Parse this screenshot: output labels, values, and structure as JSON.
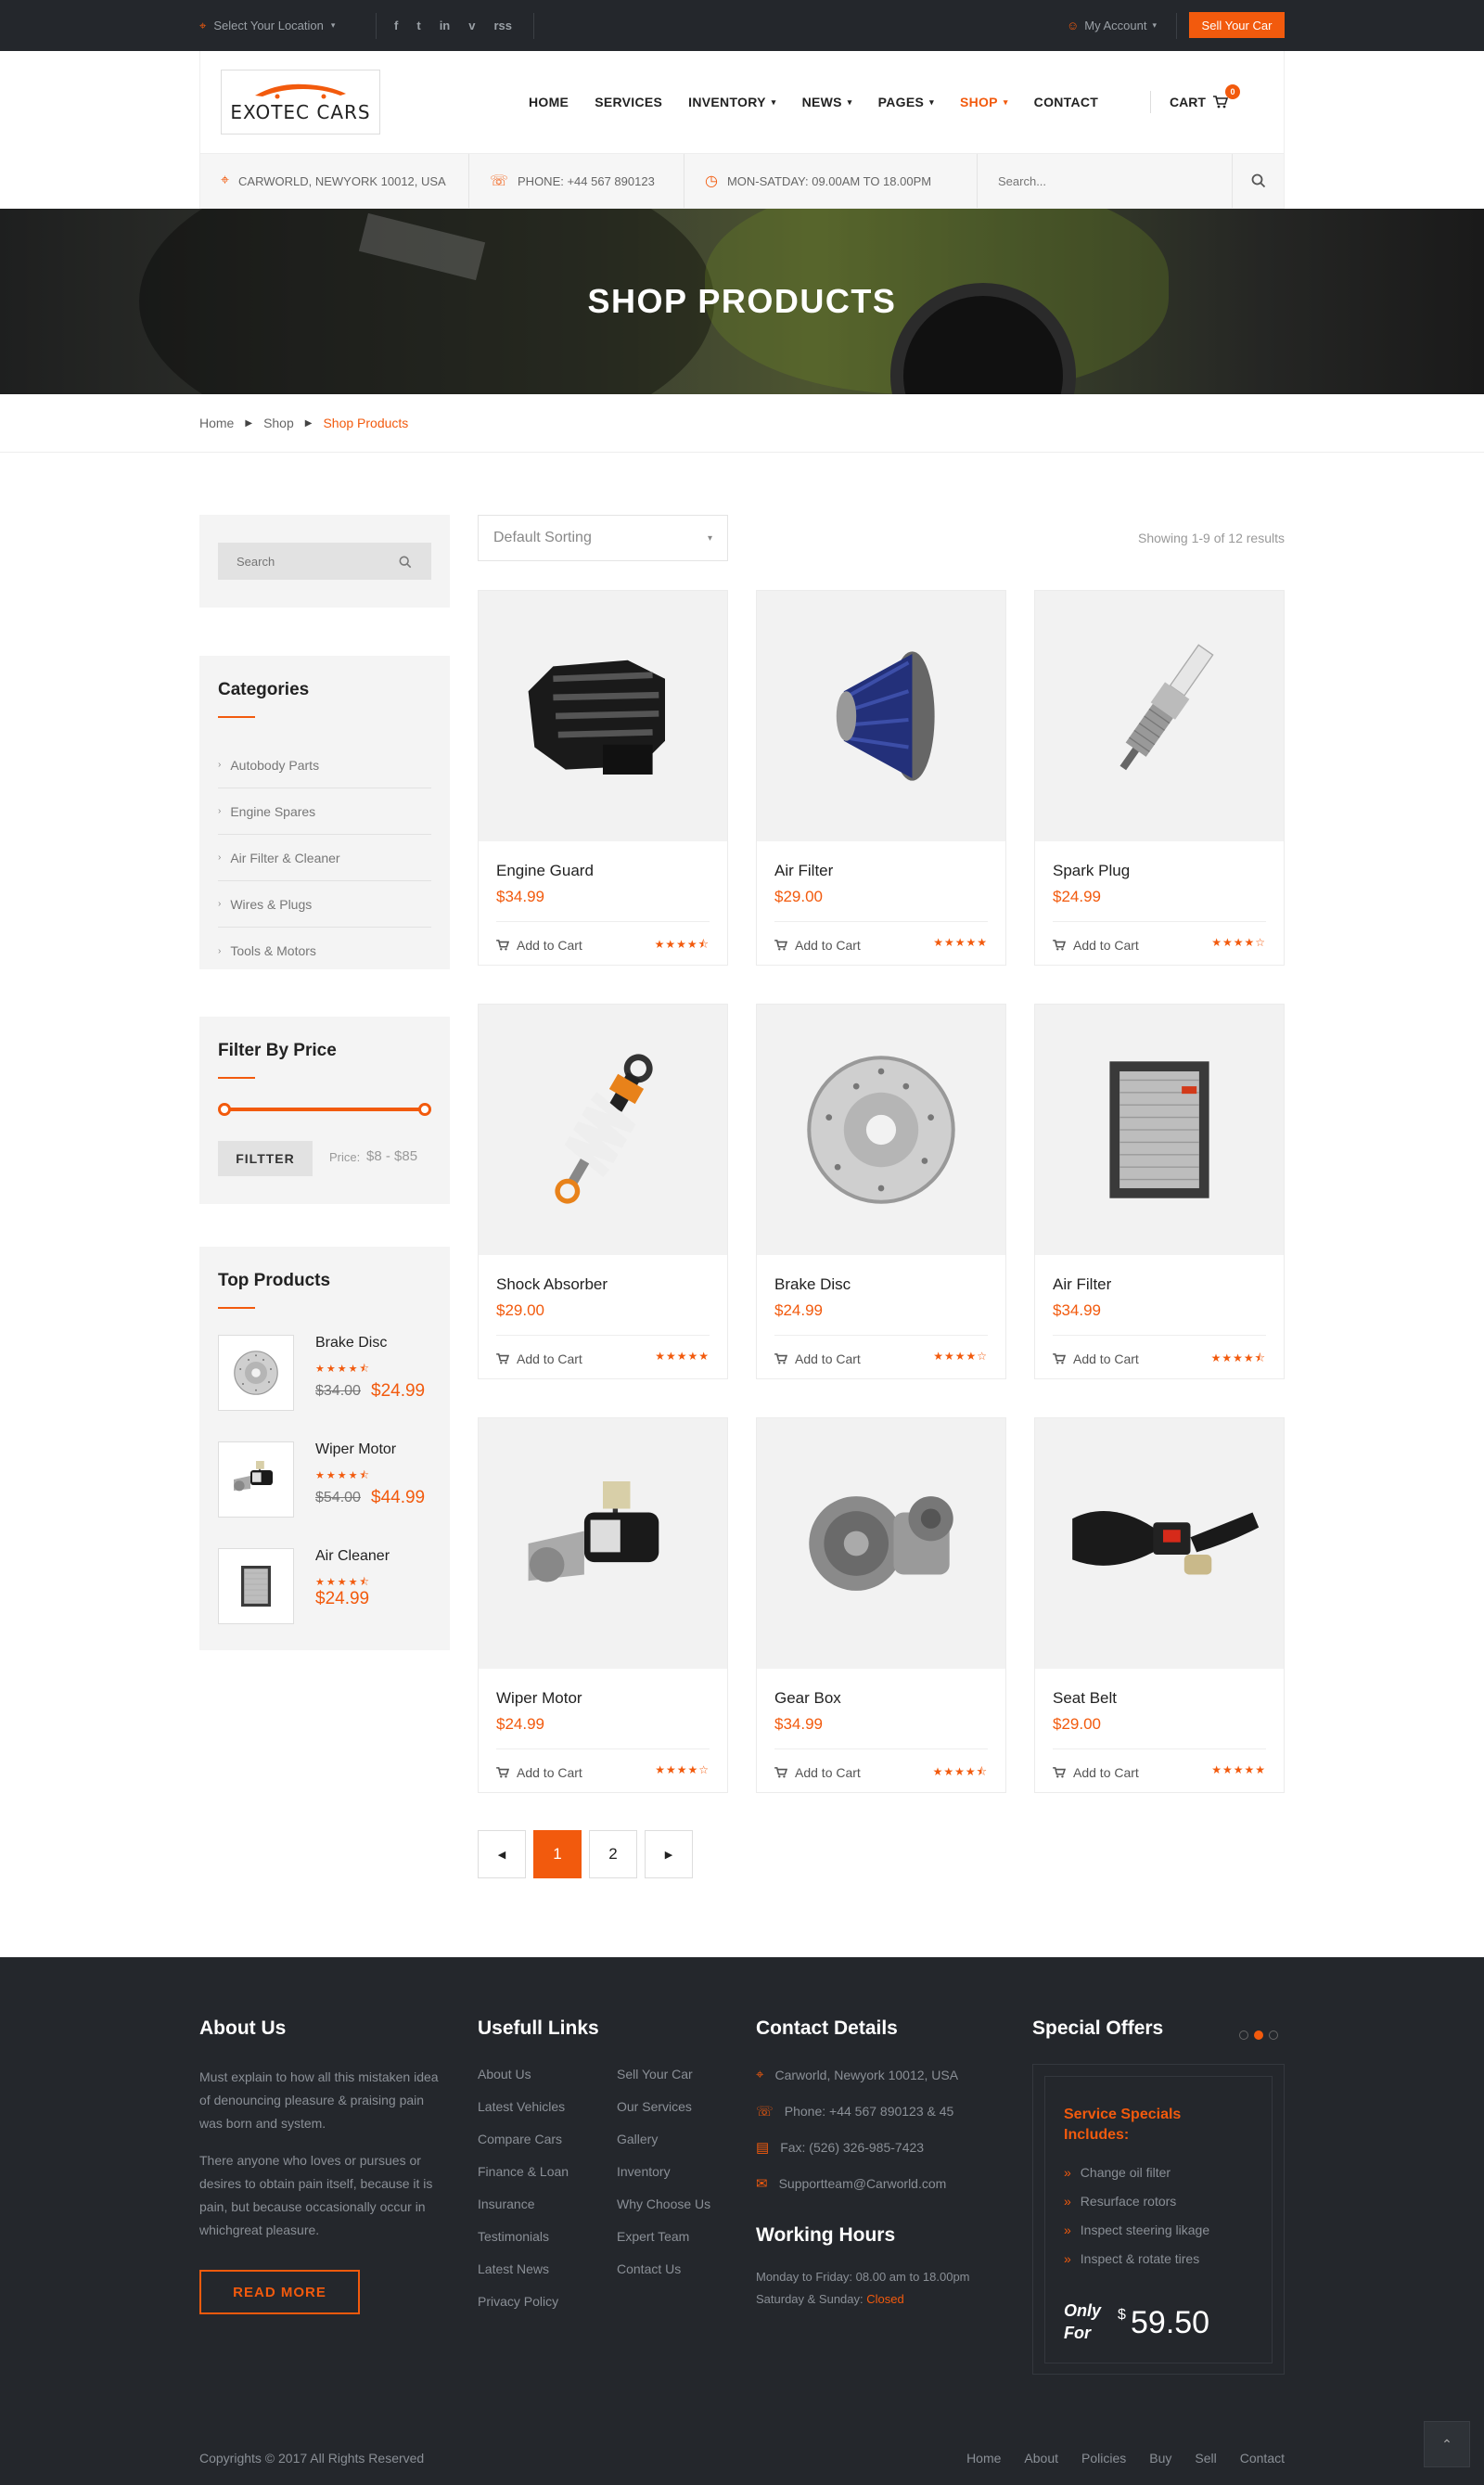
{
  "topbar": {
    "location": "Select Your Location",
    "social_icons": [
      "facebook-icon",
      "twitter-icon",
      "linkedin-icon",
      "vimeo-icon",
      "rss-icon"
    ],
    "social_glyphs": [
      "f",
      "t",
      "in",
      "v",
      "rss"
    ],
    "account": "My Account",
    "sell_button": "Sell Your Car"
  },
  "brand": {
    "name": "EXOTEC CARS",
    "accent": "#f25a0d"
  },
  "nav": [
    {
      "label": "HOME",
      "caret": false,
      "active": false
    },
    {
      "label": "SERVICES",
      "caret": false,
      "active": false
    },
    {
      "label": "INVENTORY",
      "caret": true,
      "active": false
    },
    {
      "label": "NEWS",
      "caret": true,
      "active": false
    },
    {
      "label": "PAGES",
      "caret": true,
      "active": false
    },
    {
      "label": "SHOP",
      "caret": true,
      "active": true
    },
    {
      "label": "CONTACT",
      "caret": false,
      "active": false
    }
  ],
  "cart": {
    "label": "CART",
    "count": "0"
  },
  "info": {
    "address": "CARWORLD, NEWYORK 10012, USA",
    "phone": "PHONE: +44 567 890123",
    "hours": "MON-SATDAY: 09.00AM TO 18.00PM",
    "search_placeholder": "Search..."
  },
  "hero": {
    "title": "SHOP PRODUCTS"
  },
  "breadcrumb": [
    "Home",
    "Shop",
    "Shop Products"
  ],
  "sidebar": {
    "search_placeholder": "Search",
    "categories_title": "Categories",
    "categories": [
      "Autobody Parts",
      "Engine Spares",
      "Air Filter & Cleaner",
      "Wires & Plugs",
      "Tools & Motors"
    ],
    "filter_title": "Filter By Price",
    "filter_button": "FILTTER",
    "price_label": "Price:",
    "price_range": "$8 - $85",
    "price_min_fraction": 0.0,
    "price_max_fraction": 1.0,
    "top_title": "Top Products",
    "top_products": [
      {
        "name": "Brake Disc",
        "rating": 4.5,
        "old_price": "$34.00",
        "price": "$24.99",
        "icon": "brake-disc-icon"
      },
      {
        "name": "Wiper Motor",
        "rating": 4.5,
        "old_price": "$54.00",
        "price": "$44.99",
        "icon": "wiper-motor-icon"
      },
      {
        "name": "Air Cleaner",
        "rating": 4.5,
        "old_price": "",
        "price": "$24.99",
        "icon": "air-cleaner-icon"
      }
    ]
  },
  "toolbar": {
    "sort": "Default Sorting",
    "showing": "Showing 1-9 of 12 results"
  },
  "products": [
    {
      "name": "Engine Guard",
      "price": "$34.99",
      "rating": 4.5,
      "icon": "engine-guard-icon",
      "add": "Add to Cart"
    },
    {
      "name": "Air Filter",
      "price": "$29.00",
      "rating": 5,
      "icon": "air-filter-cone-icon",
      "add": "Add to Cart"
    },
    {
      "name": "Spark Plug",
      "price": "$24.99",
      "rating": 4,
      "icon": "spark-plug-icon",
      "add": "Add to Cart"
    },
    {
      "name": "Shock Absorber",
      "price": "$29.00",
      "rating": 5,
      "icon": "shock-absorber-icon",
      "add": "Add to Cart"
    },
    {
      "name": "Brake Disc",
      "price": "$24.99",
      "rating": 4,
      "icon": "brake-disc-icon",
      "add": "Add to Cart"
    },
    {
      "name": "Air Filter",
      "price": "$34.99",
      "rating": 4.5,
      "icon": "air-filter-box-icon",
      "add": "Add to Cart"
    },
    {
      "name": "Wiper Motor",
      "price": "$24.99",
      "rating": 4,
      "icon": "wiper-motor-icon",
      "add": "Add to Cart"
    },
    {
      "name": "Gear Box",
      "price": "$34.99",
      "rating": 4.5,
      "icon": "gear-box-icon",
      "add": "Add to Cart"
    },
    {
      "name": "Seat Belt",
      "price": "$29.00",
      "rating": 5,
      "icon": "seat-belt-icon",
      "add": "Add to Cart"
    }
  ],
  "pagination": {
    "pages": [
      "1",
      "2"
    ],
    "current": "1"
  },
  "footer": {
    "about_title": "About Us",
    "about_p1": "Must explain to how all this mistaken idea of denouncing pleasure & praising pain was born and system.",
    "about_p2": "There anyone who loves or pursues or desires to obtain pain itself, because it is pain, but because occasionally occur in whichgreat pleasure.",
    "read_more": "READ MORE",
    "links_title": "Usefull Links",
    "links_col1": [
      "About Us",
      "Latest Vehicles",
      "Compare Cars",
      "Finance & Loan",
      "Insurance",
      "Testimonials",
      "Latest News",
      "Privacy Policy"
    ],
    "links_col2": [
      "Sell Your Car",
      "Our Services",
      "Gallery",
      "Inventory",
      "Why Choose Us",
      "Expert Team",
      "Contact Us"
    ],
    "contact_title": "Contact Details",
    "contact": [
      {
        "icon": "map-pin-icon",
        "glyph": "⌖",
        "text": "Carworld, Newyork 10012, USA"
      },
      {
        "icon": "phone-icon",
        "glyph": "☏",
        "text": "Phone: +44 567 890123 & 45"
      },
      {
        "icon": "fax-icon",
        "glyph": "▤",
        "text": "Fax: (526) 326-985-7423"
      },
      {
        "icon": "envelope-icon",
        "glyph": "✉",
        "text": "Supportteam@Carworld.com"
      }
    ],
    "hours_title": "Working Hours",
    "hours_weekday": "Monday to Friday: 08.00 am to 18.00pm",
    "hours_weekend_label": "Saturday & Sunday:",
    "hours_weekend_status": "Closed",
    "offers_title": "Special Offers",
    "offer_heading": "Service Specials Includes:",
    "offer_items": [
      "Change oil filter",
      "Resurface rotors",
      "Inspect steering likage",
      "Inspect & rotate tires"
    ],
    "offer_only": "Only",
    "offer_for": "For",
    "offer_currency": "$",
    "offer_amount": "59.50",
    "copyright": "Copyrights © 2017 All Rights Reserved",
    "bottom_links": [
      "Home",
      "About",
      "Policies",
      "Buy",
      "Sell",
      "Contact"
    ]
  }
}
